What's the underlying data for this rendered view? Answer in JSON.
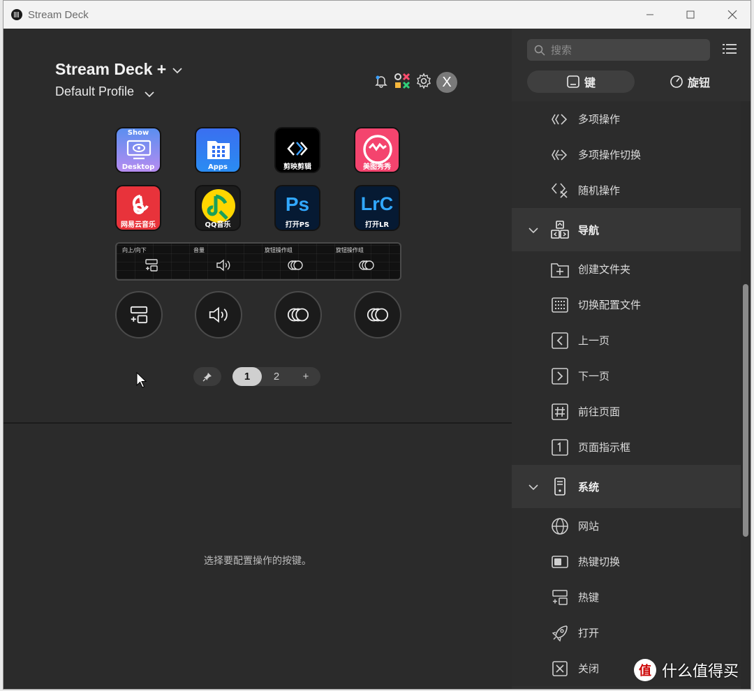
{
  "window": {
    "title": "Stream Deck"
  },
  "device": {
    "name": "Stream Deck +",
    "profile": "Default Profile",
    "avatar_letter": "X"
  },
  "keys": [
    {
      "label": "Desktop",
      "top_label": "Show"
    },
    {
      "label": "Apps"
    },
    {
      "label": "剪映剪辑"
    },
    {
      "label": "美图秀秀"
    },
    {
      "label": "网易云音乐"
    },
    {
      "label": "QQ音乐"
    },
    {
      "label": "打开PS",
      "glyph": "Ps"
    },
    {
      "label": "打开LR",
      "glyph": "LrC"
    }
  ],
  "touch_strip": [
    {
      "label": "向上/向下",
      "icon": "hotkey-icon"
    },
    {
      "label": "音量",
      "icon": "volume-icon"
    },
    {
      "label": "旋钮操作组",
      "icon": "dial-stack-icon"
    },
    {
      "label": "旋钮操作组",
      "icon": "dial-stack-icon"
    }
  ],
  "pages": {
    "items": [
      "1",
      "2"
    ],
    "active": "1",
    "add": "+"
  },
  "empty_message": "选择要配置操作的按键。",
  "sidebar": {
    "search_placeholder": "搜索",
    "tabs": [
      {
        "label": "键",
        "active": true
      },
      {
        "label": "旋钮",
        "active": false
      }
    ],
    "rows": [
      {
        "type": "item",
        "label": "多项操作",
        "icon": "multi-action-icon"
      },
      {
        "type": "item",
        "label": "多项操作切换",
        "icon": "multi-action-switch-icon"
      },
      {
        "type": "item",
        "label": "随机操作",
        "icon": "random-action-icon"
      },
      {
        "type": "cat",
        "label": "导航",
        "icon": "navigation-icon"
      },
      {
        "type": "item",
        "label": "创建文件夹",
        "icon": "create-folder-icon"
      },
      {
        "type": "item",
        "label": "切换配置文件",
        "icon": "switch-profile-icon"
      },
      {
        "type": "item",
        "label": "上一页",
        "icon": "previous-page-icon"
      },
      {
        "type": "item",
        "label": "下一页",
        "icon": "next-page-icon"
      },
      {
        "type": "item",
        "label": "前往页面",
        "icon": "goto-page-icon"
      },
      {
        "type": "item",
        "label": "页面指示框",
        "icon": "page-indicator-icon"
      },
      {
        "type": "cat",
        "label": "系统",
        "icon": "system-icon"
      },
      {
        "type": "item",
        "label": "网站",
        "icon": "globe-icon"
      },
      {
        "type": "item",
        "label": "热键切换",
        "icon": "hotkey-switch-icon"
      },
      {
        "type": "item",
        "label": "热键",
        "icon": "hotkey-icon"
      },
      {
        "type": "item",
        "label": "打开",
        "icon": "rocket-icon"
      },
      {
        "type": "item",
        "label": "关闭",
        "icon": "close-box-icon"
      }
    ]
  },
  "watermark": {
    "logo": "值",
    "text": "什么值得买"
  },
  "colors": {
    "background": "#2b2b2b",
    "sidebar": "#2f2f2f",
    "category_row": "#363636",
    "accent_active": "#cfcfcf"
  }
}
